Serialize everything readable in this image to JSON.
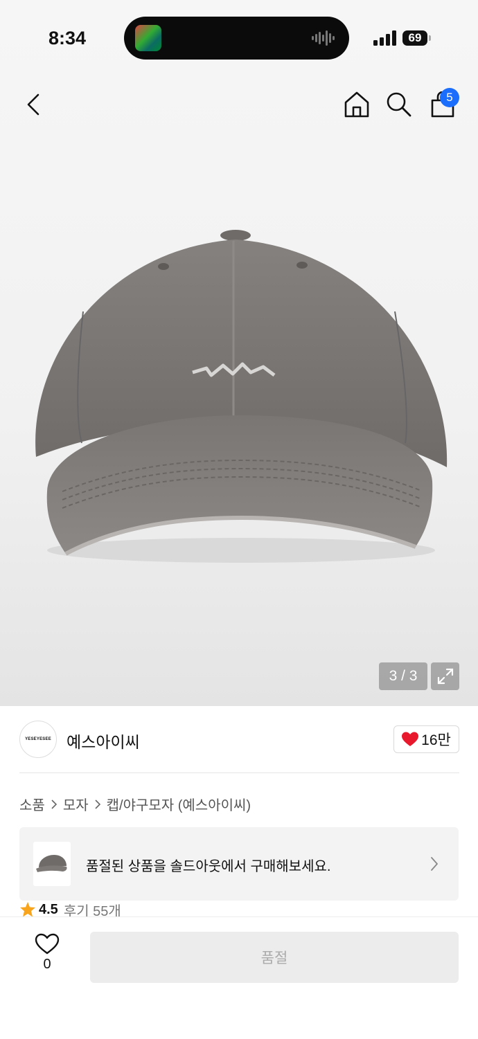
{
  "status_bar": {
    "time": "8:34",
    "battery": "69"
  },
  "header": {
    "cart_count": "5"
  },
  "gallery": {
    "counter": "3 / 3"
  },
  "brand": {
    "logo_text": "YESEYESEE",
    "name": "예스아이씨",
    "like_count": "16만"
  },
  "breadcrumb": [
    "소품",
    "모자",
    "캡/야구모자 (예스아이씨)"
  ],
  "soldout_banner": {
    "text": "품절된 상품을 솔드아웃에서 구매해보세요."
  },
  "rating": {
    "score": "4.5",
    "reviews": "후기 55개"
  },
  "bottom_bar": {
    "wish_count": "0",
    "button_label": "품절"
  },
  "colors": {
    "accent_blue": "#1b6dfb",
    "heart_red": "#e8192c",
    "star_orange": "#f8a51d",
    "cap_gray": "#7a7674"
  }
}
